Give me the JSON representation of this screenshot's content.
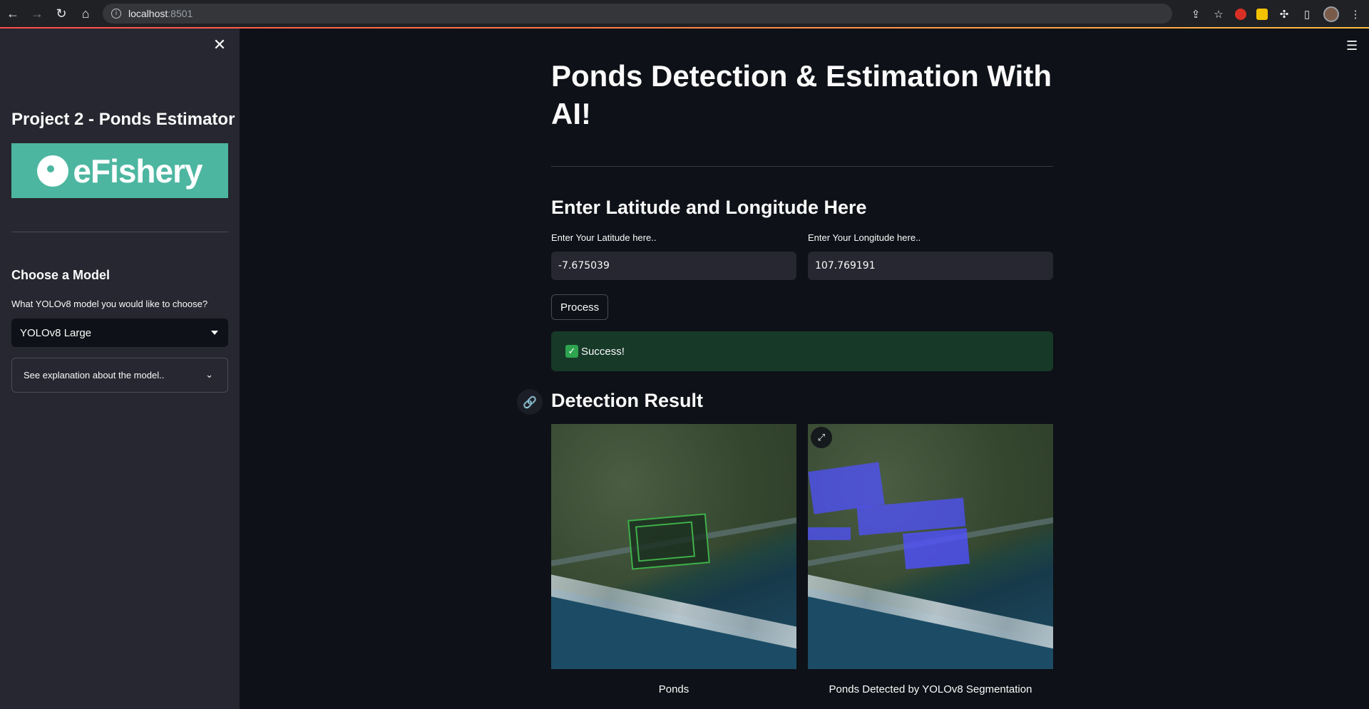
{
  "browser": {
    "url_host": "localhost",
    "url_port": ":8501",
    "info_icon": "info-icon"
  },
  "sidebar": {
    "close_icon": "✕",
    "title": "Project 2 - Ponds Estimator",
    "logo_text": "eFishery",
    "model_heading": "Choose a Model",
    "model_label": "What YOLOv8 model you would like to choose?",
    "model_selected": "YOLOv8 Large",
    "expander_label": "See explanation about the model.."
  },
  "main": {
    "title": "Ponds Detection & Estimation With AI!",
    "coords_heading": "Enter Latitude and Longitude Here",
    "latitude_label": "Enter Your Latitude here..",
    "latitude_value": "-7.675039",
    "longitude_label": "Enter Your Longitude here..",
    "longitude_value": "107.769191",
    "process_label": "Process",
    "success_text": "Success!",
    "result_heading": "Detection Result",
    "images": [
      {
        "caption": "Ponds"
      },
      {
        "caption": "Ponds Detected by YOLOv8 Segmentation"
      }
    ]
  },
  "colors": {
    "background": "#0e1117",
    "sidebar": "#262730",
    "success_bg": "#173928",
    "brand": "#4db6a0"
  }
}
